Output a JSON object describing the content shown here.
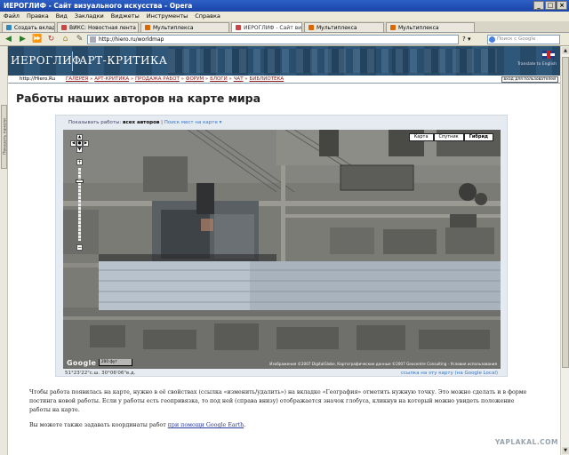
{
  "browser": {
    "title": "ИЕРОГЛИФ - Сайт визуального искусства - Opera",
    "menu": [
      "Файл",
      "Правка",
      "Вид",
      "Закладки",
      "Виджеты",
      "Инструменты",
      "Справка"
    ],
    "tabs": [
      {
        "label": "Создать вкладку",
        "active": false
      },
      {
        "label": "ВИКС: Новостная лента",
        "active": false
      },
      {
        "label": "Мультиплекса",
        "active": false
      },
      {
        "label": "ИЕРОГЛИФ - Сайт виз...",
        "active": true
      },
      {
        "label": "Мультиплекса",
        "active": false
      },
      {
        "label": "Мультиплекса",
        "active": false
      }
    ],
    "address": "http://hiero.ru/worldmap",
    "search_placeholder": "Поиск с Google"
  },
  "site": {
    "logo_left": "ИЕРОГЛИФ",
    "logo_right": "АРТ-КРИТИКА",
    "translate": "Translate to English",
    "home": "http://Hiero.Ru",
    "nav": [
      "ГАЛЕРЕЯ",
      "АРТ-КРИТИКА",
      "ПРОДАЖА РАБОТ",
      "ФОРУМ",
      "БЛОГИ",
      "ЧАТ",
      "БИБЛИОТЕКА"
    ],
    "nav_sep": " » ",
    "login": "вход для пользователей",
    "side_panel": "Показать панели"
  },
  "page": {
    "title": "Работы наших авторов на карте мира",
    "map": {
      "show_label": "Показывать работы:",
      "show_value": "всех авторов",
      "separator": "|",
      "search_link": "Поиск мест на карте ▾",
      "types": [
        "Карта",
        "Спутник",
        "Гибрид"
      ],
      "active_type": "Гибрид",
      "coords": "51°23'22\"с.ш.  30°06'06\"в.д.",
      "link_text": "ссылка на эту карту (на Google Local)",
      "copyright": "Изображения ©2007 DigitalGlobe, Картографические данные ©2007 Geocentre Consulting - Условия использования",
      "google": "Google",
      "scale": "200 фут"
    },
    "para1": "Чтобы работа появилась на карте, нужно в её свойствах (ссылка «изменить/удалить») на вкладке «География» отметить нужную точку. Это можно сделать и в форме постинга новой работы. Если у работы есть геопривязка, то под ней (справа внизу) отображается значок глобуса, кликнув на который можно увидеть положение работы на карте.",
    "para2_text": "Вы можете также задавать координаты работ ",
    "para2_link": "при помощи Google Earth",
    "para2_end": "."
  },
  "watermark": "YAPLAKAL.COM"
}
